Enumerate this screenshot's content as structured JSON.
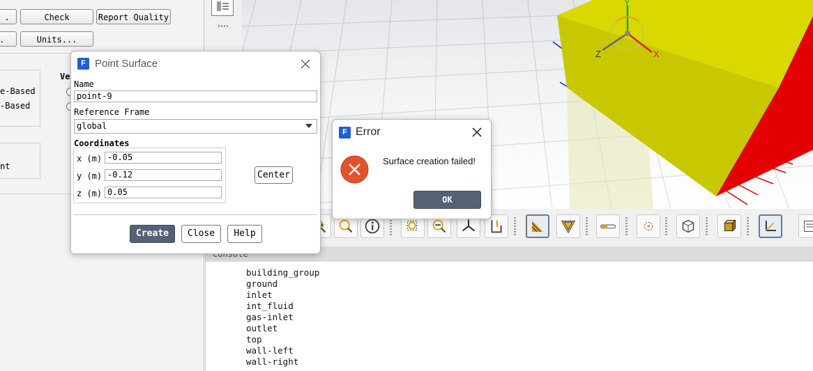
{
  "left_panel": {
    "buttons": {
      "check": "Check",
      "report_quality": "Report Quality",
      "units": "Units...",
      "dot1": ".",
      "dot2": "."
    },
    "velocity_label": "Ve",
    "solver_options": [
      "e-Based",
      "-Based"
    ],
    "group_text": "nt"
  },
  "console": {
    "header": "Console",
    "lines": [
      "building_group",
      "ground",
      "inlet",
      "int_fluid",
      "gas-inlet",
      "outlet",
      "top",
      "wall-left",
      "wall-right"
    ]
  },
  "graphics": {
    "axis_labels": {
      "x": "X",
      "y": "Y",
      "z": "Z"
    }
  },
  "point_surface_dialog": {
    "title": "Point Surface",
    "icon_letter": "F",
    "name_label": "Name",
    "name_value": "point-9",
    "reference_frame_label": "Reference Frame",
    "reference_frame_value": "global",
    "coordinates_label": "Coordinates",
    "x_label": "x (m)",
    "x_value": "-0.05",
    "y_label": "y (m)",
    "y_value": "-0.12",
    "z_label": "z (m)",
    "z_value": "0.05",
    "center_button": "Center",
    "create_button": "Create",
    "close_button": "Close",
    "help_button": "Help"
  },
  "error_dialog": {
    "title": "Error",
    "icon_letter": "F",
    "message": "Surface creation failed!",
    "ok_button": "OK"
  },
  "colors": {
    "accent": "#556276",
    "error_icon": "#e2532d",
    "fluent_blue": "#1f5fd1",
    "box_yellow": "#cccc00",
    "box_red": "#e00000"
  }
}
